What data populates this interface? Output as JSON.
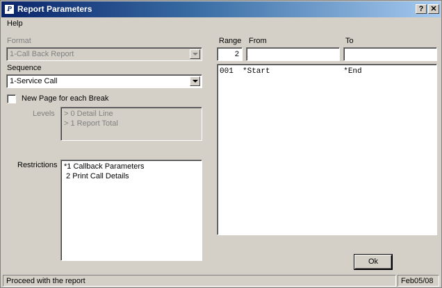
{
  "window": {
    "title": "Report Parameters",
    "help_btn": "?",
    "close_btn": "✕"
  },
  "menu": {
    "help": "Help"
  },
  "format": {
    "label": "Format",
    "value": "1-Call Back Report"
  },
  "sequence": {
    "label": "Sequence",
    "value": "1-Service Call"
  },
  "new_page": {
    "label": "New Page for each Break",
    "checked": false
  },
  "levels": {
    "label": "Levels",
    "items": [
      "> 0 Detail Line",
      "> 1 Report Total"
    ]
  },
  "restrictions": {
    "label": "Restrictions",
    "items": [
      "*1 Callback Parameters",
      " 2 Print Call Details"
    ]
  },
  "range": {
    "label": "Range",
    "value": "2",
    "from_label": "From",
    "from_value": "",
    "to_label": "To",
    "to_value": ""
  },
  "range_list": {
    "line": "001  *Start                *End"
  },
  "ok_button": "Ok",
  "status": {
    "message": "Proceed with the report",
    "date": "Feb05/08"
  }
}
